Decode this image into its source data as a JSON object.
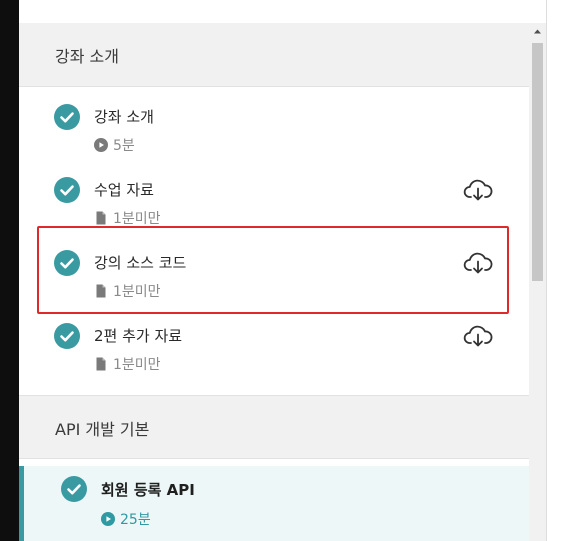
{
  "sections": [
    {
      "title": "강좌 소개",
      "lessons": [
        {
          "name": "강좌 소개",
          "meta_icon": "play-icon",
          "meta": "5분",
          "download": false,
          "completed": true
        },
        {
          "name": "수업 자료",
          "meta_icon": "document-icon",
          "meta": "1분미만",
          "download": true,
          "completed": true
        },
        {
          "name": "강의 소스 코드",
          "meta_icon": "document-icon",
          "meta": "1분미만",
          "download": true,
          "completed": true,
          "highlighted": true
        },
        {
          "name": "2편 추가 자료",
          "meta_icon": "document-icon",
          "meta": "1분미만",
          "download": true,
          "completed": true
        }
      ]
    },
    {
      "title": "API 개발 기본",
      "lessons": [
        {
          "name": "회원 등록 API",
          "meta_icon": "play-icon",
          "meta": "25분",
          "download": false,
          "completed": true,
          "active": true
        }
      ]
    }
  ],
  "colors": {
    "accent": "#3a9aa2",
    "highlight_border": "#e02a2a",
    "section_bg": "#f1f1f1",
    "active_bg": "#eef7f7"
  }
}
